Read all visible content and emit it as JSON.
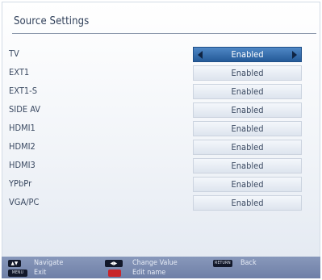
{
  "screen": {
    "title": "Source Settings"
  },
  "sources": [
    {
      "label": "TV",
      "value": "Enabled",
      "selected": true
    },
    {
      "label": "EXT1",
      "value": "Enabled"
    },
    {
      "label": "EXT1-S",
      "value": "Enabled"
    },
    {
      "label": "SIDE AV",
      "value": "Enabled"
    },
    {
      "label": "HDMI1",
      "value": "Enabled"
    },
    {
      "label": "HDMI2",
      "value": "Enabled"
    },
    {
      "label": "HDMI3",
      "value": "Enabled"
    },
    {
      "label": "YPbPr",
      "value": "Enabled"
    },
    {
      "label": "VGA/PC",
      "value": "Enabled"
    }
  ],
  "footer": {
    "navigate_label": "Navigate",
    "change_value_label": "Change Value",
    "back_label": "Back",
    "exit_label": "Exit",
    "edit_name_label": "Edit name",
    "menu_key": "MENU",
    "return_key": "RETURN",
    "icons": {
      "navigate": "up-down-arrows-icon",
      "change_value": "left-right-arrows-icon",
      "back": "return-key-icon",
      "exit": "menu-key-icon",
      "edit_name": "red-button-icon"
    }
  },
  "colors": {
    "selected_value_bg": "#2f6aad",
    "footer_bg": "#7d8db2",
    "text": "#3b4a62",
    "red_button": "#c8242a"
  }
}
